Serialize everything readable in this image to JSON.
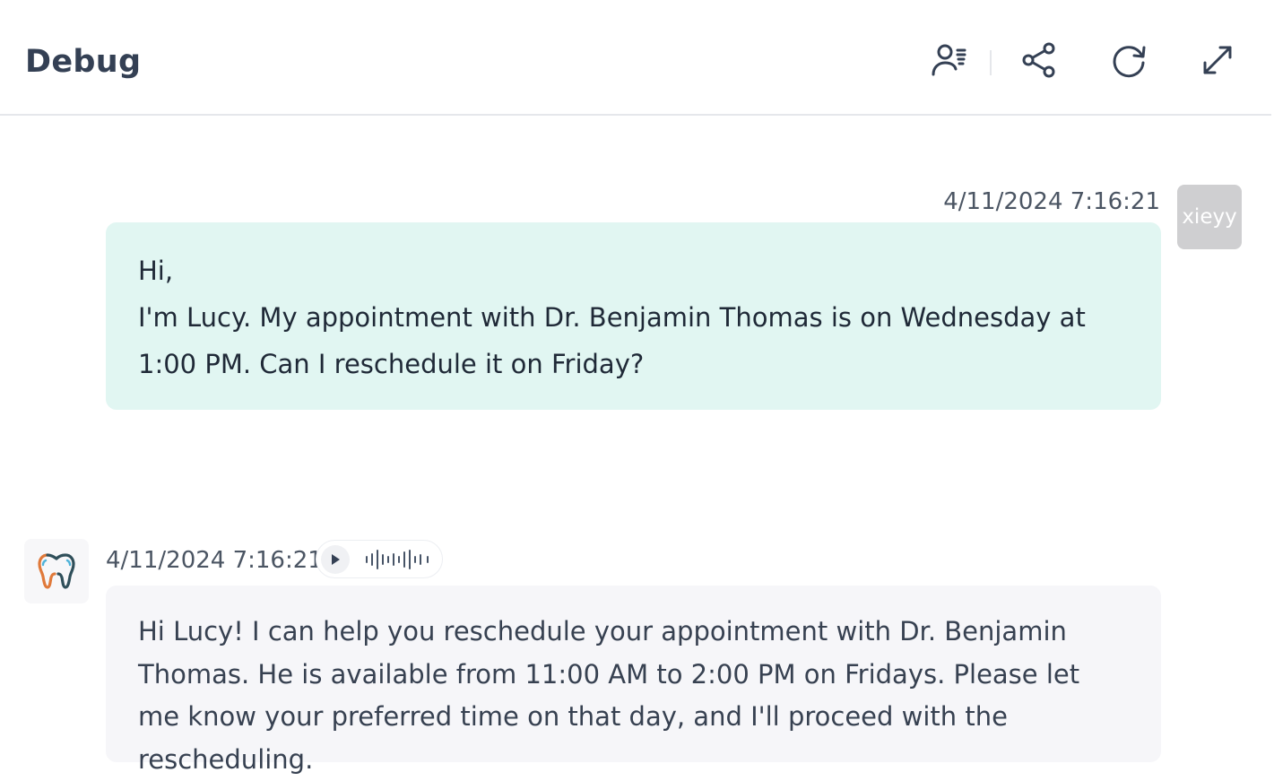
{
  "header": {
    "title": "Debug",
    "icons": [
      "user-list-icon",
      "share-icon",
      "refresh-icon",
      "expand-icon"
    ],
    "accent_color": "#344054"
  },
  "messages": {
    "user": {
      "timestamp": "4/11/2024 7:16:21",
      "avatar_text": "xieyy",
      "lines": [
        "Hi,",
        "I'm Lucy. My appointment with Dr. Benjamin Thomas is on Wednesday at 1:00 PM. Can I reschedule it on Friday?"
      ],
      "bubble_color": "#e1f6f2"
    },
    "bot": {
      "timestamp": "4/11/2024 7:16:21",
      "avatar_icon": "tooth-icon",
      "text": "Hi Lucy! I can help you reschedule your appointment with Dr. Benjamin Thomas. He is available from 11:00 AM to 2:00 PM on Fridays. Please let me know your preferred time on that day, and I'll proceed with the rescheduling.",
      "bubble_color": "#f6f6f9"
    }
  }
}
